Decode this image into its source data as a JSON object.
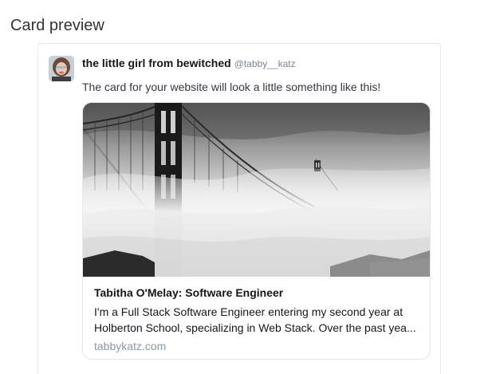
{
  "section": {
    "title": "Card preview"
  },
  "tweet": {
    "display_name": "the little girl from bewitched",
    "handle": "@tabby__katz",
    "text": "The card for your website will look a little something like this!"
  },
  "card": {
    "title": "Tabitha O'Melay: Software Engineer",
    "description_line1": "I'm a Full Stack Software Engineer entering my second year at",
    "description_line2": "Holberton School, specializing in Web Stack. Over the past yea...",
    "domain": "tabbykatz.com",
    "image_icon": "golden-gate-bridge-in-fog"
  },
  "colors": {
    "border": "#e1e8ed",
    "muted_text": "#8899a6",
    "handle_text": "#7a8793"
  }
}
